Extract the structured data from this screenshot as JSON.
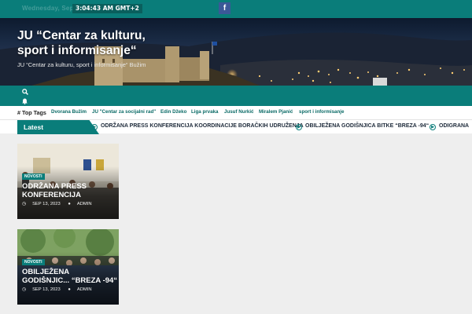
{
  "topbar": {
    "date": "Wednesday, Sep 13",
    "clock": "3:04:43 AM GMT+2",
    "facebook_icon": "facebook-icon"
  },
  "hero": {
    "site_title": "JU “Centar za kulturu, sport i informisanje“",
    "tagline": "JU “Centar za kulturu, sport i informisanje“ Bužim"
  },
  "nav": {
    "search_icon": "search-icon",
    "bell_icon": "bell-icon"
  },
  "tags": {
    "label": "# Top Tags",
    "items": [
      "Dvorana Bužim",
      "JU \"Centar za socijalni rad\"",
      "Edin Džeko",
      "Liga prvaka",
      "Jusuf Nurkić",
      "Miralem Pjanić",
      "sport i informisanje"
    ]
  },
  "latest": {
    "label": "Latest",
    "items": [
      "ODRŽANA PRESS KONFERENCIJA KOORDINACIJE BORAČKIH UDRUŽENJA",
      "OBILJEŽENA GODIŠNJICA BITKE “BREZA -94“",
      "ODIGRANA"
    ]
  },
  "posts": [
    {
      "category": "NOVOSTI",
      "title_line1": "ODRŽANA PRESS",
      "title_line2": "KONFERENCIJA",
      "date": "SEP 13, 2023",
      "author": "ADMIN"
    },
    {
      "category": "NOVOSTI",
      "title_line1": "OBILJEŽENA",
      "title_line2": "GODIŠNJIC... “BREZA -94“",
      "date": "SEP 13, 2023",
      "author": "ADMIN"
    }
  ],
  "colors": {
    "brand": "#0a7d7a",
    "brand_dark": "#0a5f5d",
    "facebook": "#3b5998"
  }
}
